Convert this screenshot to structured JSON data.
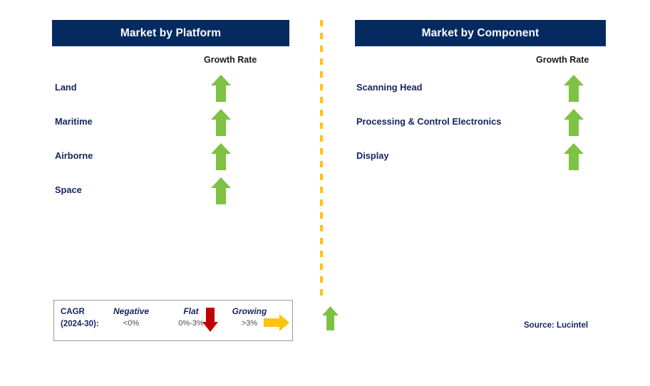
{
  "colors": {
    "header_navy": "#042A60",
    "label_navy": "#14245E",
    "arrow_green": "#7DC242",
    "arrow_red": "#C00000",
    "arrow_yellow": "#FFC20E",
    "divider_yellow": "#FFC20E",
    "legend_border": "#9A9A9A",
    "background": "#FFFFFF"
  },
  "left_panel": {
    "title": "Market by Platform",
    "growth_rate_label": "Growth Rate",
    "rows": [
      {
        "label": "Land",
        "trend": "growing",
        "icon": "arrow-up-icon"
      },
      {
        "label": "Maritime",
        "trend": "growing",
        "icon": "arrow-up-icon"
      },
      {
        "label": "Airborne",
        "trend": "growing",
        "icon": "arrow-up-icon"
      },
      {
        "label": "Space",
        "trend": "growing",
        "icon": "arrow-up-icon"
      }
    ]
  },
  "right_panel": {
    "title": "Market by Component",
    "growth_rate_label": "Growth Rate",
    "rows": [
      {
        "label": "Scanning Head",
        "trend": "growing",
        "icon": "arrow-up-icon"
      },
      {
        "label": "Processing & Control Electronics",
        "trend": "growing",
        "icon": "arrow-up-icon"
      },
      {
        "label": "Display",
        "trend": "growing",
        "icon": "arrow-up-icon"
      }
    ]
  },
  "legend": {
    "cagr_line1": "CAGR",
    "cagr_line2": "(2024-30):",
    "items": [
      {
        "title": "Negative",
        "range": "<0%",
        "icon": "arrow-down-icon",
        "color": "#C00000"
      },
      {
        "title": "Flat",
        "range": "0%-3%",
        "icon": "arrow-right-icon",
        "color": "#FFC20E"
      },
      {
        "title": "Growing",
        "range": ">3%",
        "icon": "arrow-up-icon",
        "color": "#7DC242"
      }
    ]
  },
  "source": "Source: Lucintel"
}
